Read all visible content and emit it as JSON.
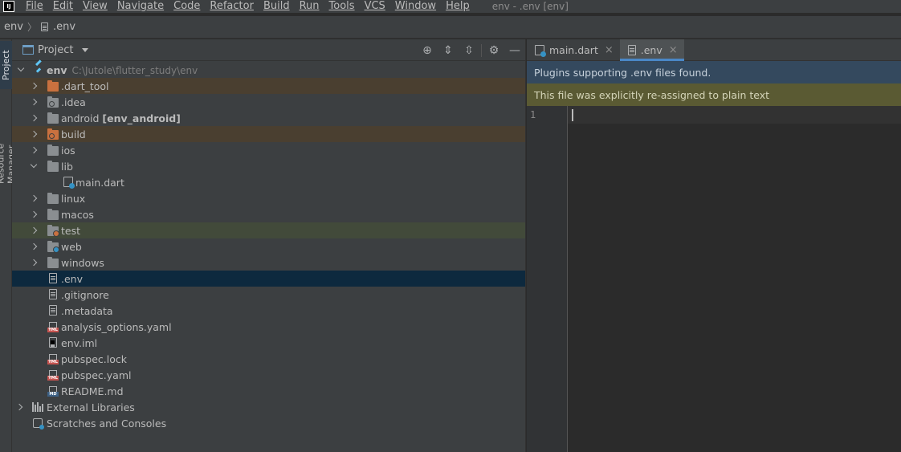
{
  "menubar": {
    "logo": "IJ",
    "items": [
      "File",
      "Edit",
      "View",
      "Navigate",
      "Code",
      "Refactor",
      "Build",
      "Run",
      "Tools",
      "VCS",
      "Window",
      "Help"
    ],
    "window_title": "env - .env [env]"
  },
  "navbar": {
    "root": "env",
    "file": ".env"
  },
  "toolstrip": {
    "project": "Project",
    "resource_manager": "Resource Manager"
  },
  "project_panel": {
    "title": "Project",
    "tools": [
      "locate-icon",
      "expand-all-icon",
      "collapse-all-icon",
      "gear-icon",
      "minimize-icon"
    ],
    "root": {
      "name": "env",
      "path": "C:\\Jutole\\flutter_study\\env"
    },
    "items": [
      {
        "label": ".dart_tool"
      },
      {
        "label": ".idea"
      },
      {
        "label": "android",
        "module": "[env_android]"
      },
      {
        "label": "build"
      },
      {
        "label": "ios"
      },
      {
        "label": "lib"
      },
      {
        "label": "main.dart"
      },
      {
        "label": "linux"
      },
      {
        "label": "macos"
      },
      {
        "label": "test"
      },
      {
        "label": "web"
      },
      {
        "label": "windows"
      },
      {
        "label": ".env"
      },
      {
        "label": ".gitignore"
      },
      {
        "label": ".metadata"
      },
      {
        "label": "analysis_options.yaml"
      },
      {
        "label": "env.iml"
      },
      {
        "label": "pubspec.lock"
      },
      {
        "label": "pubspec.yaml"
      },
      {
        "label": "README.md"
      }
    ],
    "external_libraries": "External Libraries",
    "scratches": "Scratches and Consoles"
  },
  "editor": {
    "tabs": [
      {
        "label": "main.dart",
        "active": false
      },
      {
        "label": ".env",
        "active": true
      }
    ],
    "banner_plugins": "Plugins supporting .env files found.",
    "banner_plaintext": "This file was explicitly re-assigned to plain text",
    "line_number": "1"
  },
  "colors": {
    "selection": "#0d293e",
    "excluded": "#4a3f30",
    "test_dir": "#424a3a",
    "banner_blue": "#34495e",
    "banner_olive": "#5a5a33",
    "tab_accent": "#4a88c7"
  }
}
